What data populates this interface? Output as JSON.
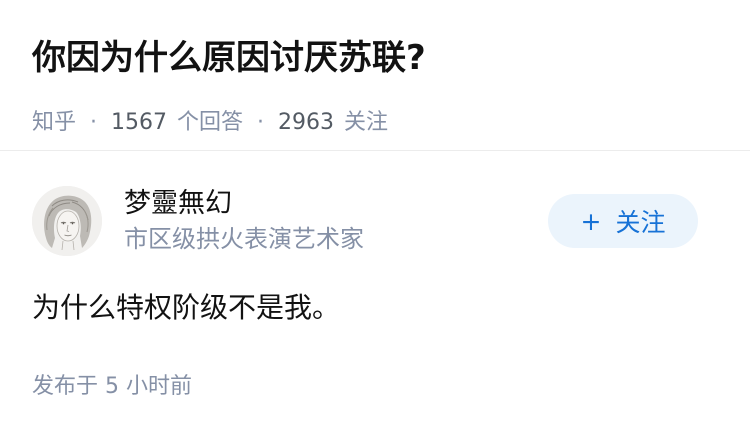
{
  "question": {
    "title": "你因为什么原因讨厌苏联?",
    "source": "知乎",
    "separator": "·",
    "answer_count": "1567",
    "answer_label": "个回答",
    "follower_count": "2963",
    "follower_label": "关注"
  },
  "answer": {
    "author": {
      "name": "梦靈無幻",
      "headline": "市区级拱火表演艺术家",
      "avatar_icon": "portrait-sketch-avatar"
    },
    "follow_button": {
      "plus": "+",
      "label": "关注"
    },
    "content": "为什么特权阶级不是我。",
    "publish_time": "发布于 5 小时前"
  },
  "colors": {
    "title": "#121212",
    "meta": "#8590a6",
    "follow_bg": "#ebf4fc",
    "follow_text": "#1772d6",
    "divider": "#ececec"
  }
}
